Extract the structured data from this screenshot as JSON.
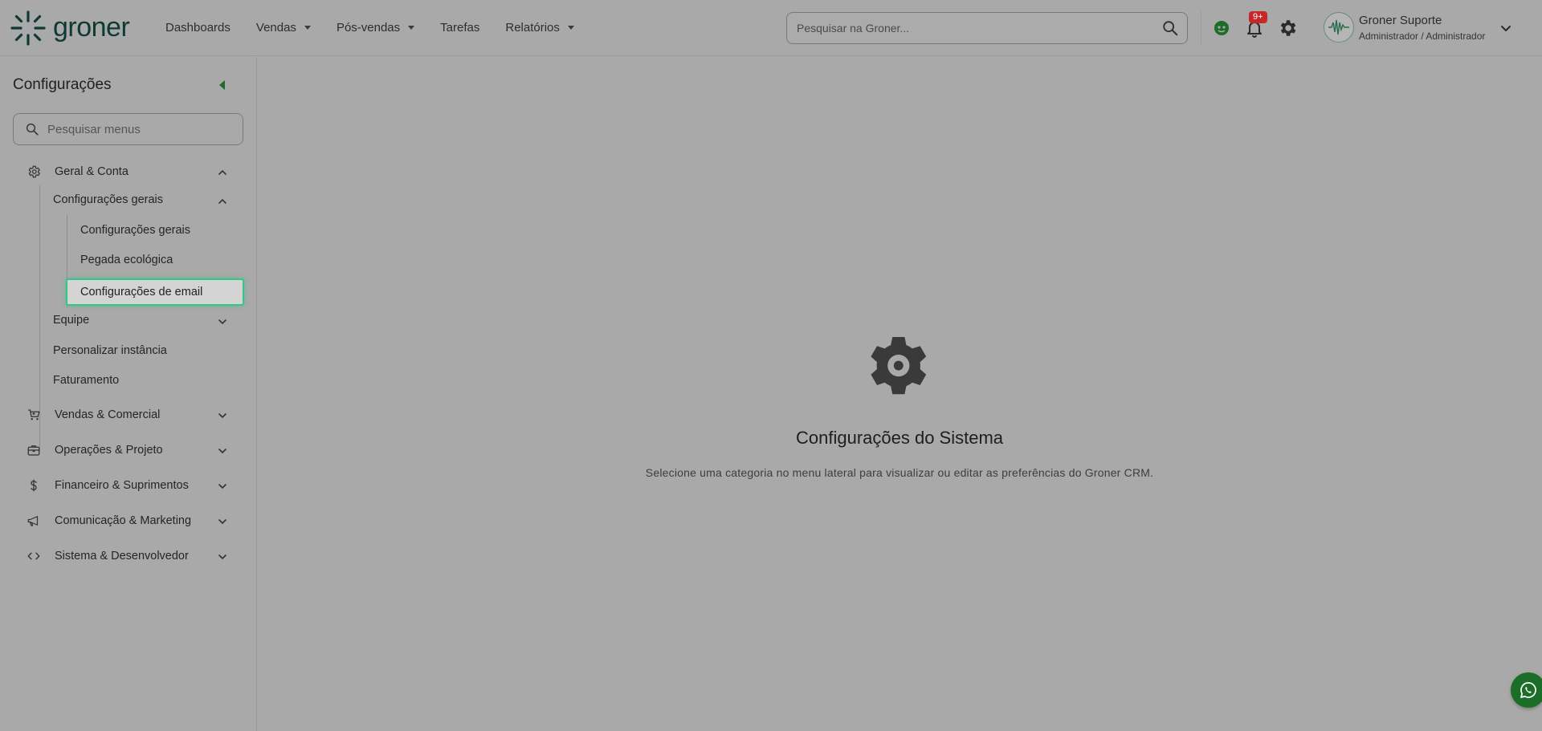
{
  "brand": {
    "name": "groner",
    "color": "#0e3a33"
  },
  "topnav": [
    {
      "label": "Dashboards",
      "dropdown": false
    },
    {
      "label": "Vendas",
      "dropdown": true
    },
    {
      "label": "Pós-vendas",
      "dropdown": true
    },
    {
      "label": "Tarefas",
      "dropdown": false
    },
    {
      "label": "Relatórios",
      "dropdown": true
    }
  ],
  "search": {
    "placeholder": "Pesquisar na Groner..."
  },
  "notifications": {
    "badge": "9+"
  },
  "user": {
    "name": "Groner Suporte",
    "role": "Administrador / Administrador"
  },
  "sidebar": {
    "title": "Configurações",
    "search_placeholder": "Pesquisar menus",
    "groups": [
      {
        "label": "Geral & Conta",
        "icon": "gear-icon",
        "expanded": true
      },
      {
        "label": "Vendas & Comercial",
        "icon": "cart-icon",
        "expanded": false
      },
      {
        "label": "Operações & Projeto",
        "icon": "briefcase-icon",
        "expanded": false
      },
      {
        "label": "Financeiro & Suprimentos",
        "icon": "dollar-icon",
        "expanded": false
      },
      {
        "label": "Comunicação & Marketing",
        "icon": "megaphone-icon",
        "expanded": false
      },
      {
        "label": "Sistema & Desenvolvedor",
        "icon": "code-icon",
        "expanded": false
      }
    ],
    "geral_children": [
      {
        "label": "Configurações gerais",
        "expanded": true
      },
      {
        "label": "Equipe",
        "expanded": false
      },
      {
        "label": "Personalizar instância"
      },
      {
        "label": "Faturamento"
      }
    ],
    "config_gerais_children": [
      {
        "label": "Configurações gerais"
      },
      {
        "label": "Pegada ecológica"
      },
      {
        "label": "Configurações de email",
        "active": true
      }
    ]
  },
  "main": {
    "title": "Configurações do Sistema",
    "description": "Selecione uma categoria no menu lateral para visualizar ou editar as preferências do Groner CRM."
  },
  "colors": {
    "accent_green": "#35c48a",
    "brand_green": "#1f6b2a",
    "badge_red": "#c62828"
  }
}
